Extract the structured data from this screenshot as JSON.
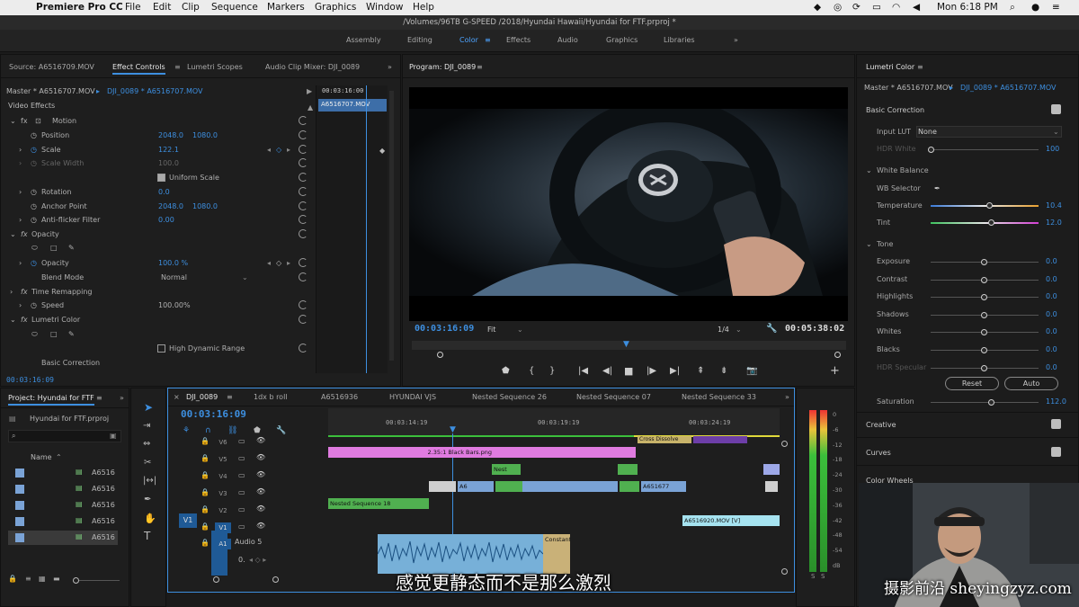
{
  "menubar": {
    "app": "Premiere Pro CC",
    "items": [
      "File",
      "Edit",
      "Clip",
      "Sequence",
      "Markers",
      "Graphics",
      "Window",
      "Help"
    ],
    "clock": "Mon 6:18 PM"
  },
  "title": "/Volumes/96TB G-SPEED /2018/Hyundai Hawaii/Hyundai for FTF.prproj *",
  "workspaces": [
    "Assembly",
    "Editing",
    "Color",
    "Effects",
    "Audio",
    "Graphics",
    "Libraries"
  ],
  "active_workspace": "Color",
  "source_panel": {
    "tabs": [
      "Source: A6516709.MOV",
      "Effect Controls",
      "Lumetri Scopes",
      "Audio Clip Mixer: DJI_0089"
    ],
    "master": "Master * A6516707.MOV",
    "clip": "DJI_0089 * A6516707.MOV",
    "mini_timecode": "00:03:16:00",
    "mini_clip": "A6516707.MOV",
    "video_effects": "Video Effects",
    "rows": [
      {
        "label": "Motion",
        "v1": "",
        "v2": ""
      },
      {
        "label": "Position",
        "v1": "2048.0",
        "v2": "1080.0"
      },
      {
        "label": "Scale",
        "v1": "122.1",
        "v2": ""
      },
      {
        "label": "Scale Width",
        "v1": "100.0",
        "v2": ""
      },
      {
        "label": "Uniform Scale",
        "v1": "",
        "v2": ""
      },
      {
        "label": "Rotation",
        "v1": "0.0",
        "v2": ""
      },
      {
        "label": "Anchor Point",
        "v1": "2048.0",
        "v2": "1080.0"
      },
      {
        "label": "Anti-flicker Filter",
        "v1": "0.00",
        "v2": ""
      },
      {
        "label": "Opacity",
        "v1": "",
        "v2": ""
      },
      {
        "label": "Opacity",
        "v1": "100.0 %",
        "v2": ""
      },
      {
        "label": "Blend Mode",
        "v1": "Normal",
        "v2": ""
      },
      {
        "label": "Time Remapping",
        "v1": "",
        "v2": ""
      },
      {
        "label": "Speed",
        "v1": "100.00%",
        "v2": ""
      },
      {
        "label": "Lumetri Color",
        "v1": "",
        "v2": ""
      },
      {
        "label": "High Dynamic Range",
        "v1": "",
        "v2": ""
      },
      {
        "label": "Basic Correction",
        "v1": "",
        "v2": ""
      }
    ],
    "timecode": "00:03:16:09"
  },
  "program": {
    "title": "Program: DJI_0089",
    "timecode": "00:03:16:09",
    "fit": "Fit",
    "resolution": "1/4",
    "duration": "00:05:38:02"
  },
  "lumetri": {
    "title": "Lumetri Color",
    "master": "Master * A6516707.MOV",
    "clip": "DJI_0089 * A6516707.MOV",
    "basic_correction": "Basic Correction",
    "input_lut_label": "Input LUT",
    "input_lut_value": "None",
    "hdr_white_label": "HDR White",
    "hdr_white_value": "100",
    "white_balance": "White Balance",
    "wb_selector": "WB Selector",
    "temperature_label": "Temperature",
    "temperature_value": "10.4",
    "tint_label": "Tint",
    "tint_value": "12.0",
    "tone": "Tone",
    "tone_rows": [
      {
        "label": "Exposure",
        "value": "0.0"
      },
      {
        "label": "Contrast",
        "value": "0.0"
      },
      {
        "label": "Highlights",
        "value": "0.0"
      },
      {
        "label": "Shadows",
        "value": "0.0"
      },
      {
        "label": "Whites",
        "value": "0.0"
      },
      {
        "label": "Blacks",
        "value": "0.0"
      },
      {
        "label": "HDR Specular",
        "value": "0.0"
      }
    ],
    "reset": "Reset",
    "auto": "Auto",
    "saturation_label": "Saturation",
    "saturation_value": "112.0",
    "sections": [
      "Creative",
      "Curves",
      "Color Wheels"
    ]
  },
  "project": {
    "title": "Project: Hyundai for FTF",
    "file": "Hyundai for FTF.prproj",
    "name_col": "Name",
    "items": [
      "A6516",
      "A6516",
      "A6516",
      "A6516",
      "A6516"
    ]
  },
  "timeline": {
    "tabs": [
      "DJI_0089",
      "1dx b roll",
      "A6516936",
      "HYUNDAI VJS",
      "Nested Sequence 26",
      "Nested Sequence 07",
      "Nested Sequence 33"
    ],
    "timecode": "00:03:16:09",
    "ruler": [
      "00:03:14:19",
      "00:03:19:19",
      "00:03:24:19"
    ],
    "tracks": [
      "V6",
      "V5",
      "V4",
      "V3",
      "V2",
      "V1",
      "A1"
    ],
    "source_v1": "V1",
    "audio_name": "Audio 5",
    "audio_value": "0.",
    "clips": {
      "cross": "Cross Dissolve",
      "bars": "2.35:1 Black Bars.png",
      "nest_short": "Nest",
      "nested18": "Nested Sequence 18",
      "a65": "A6",
      "a65b": "A6516",
      "a65c": "A651677",
      "v1clip": "A6516920.MOV [V]",
      "constant": "Constant"
    }
  },
  "meters": {
    "scale": [
      "0",
      "-6",
      "-12",
      "-18",
      "-24",
      "-30",
      "-36",
      "-42",
      "-48",
      "-54",
      "dB"
    ],
    "solo": [
      "S",
      "S"
    ]
  },
  "subtitle": "感觉更静态而不是那么激烈",
  "watermark": "摄影前沿 sheyingzyz.com"
}
